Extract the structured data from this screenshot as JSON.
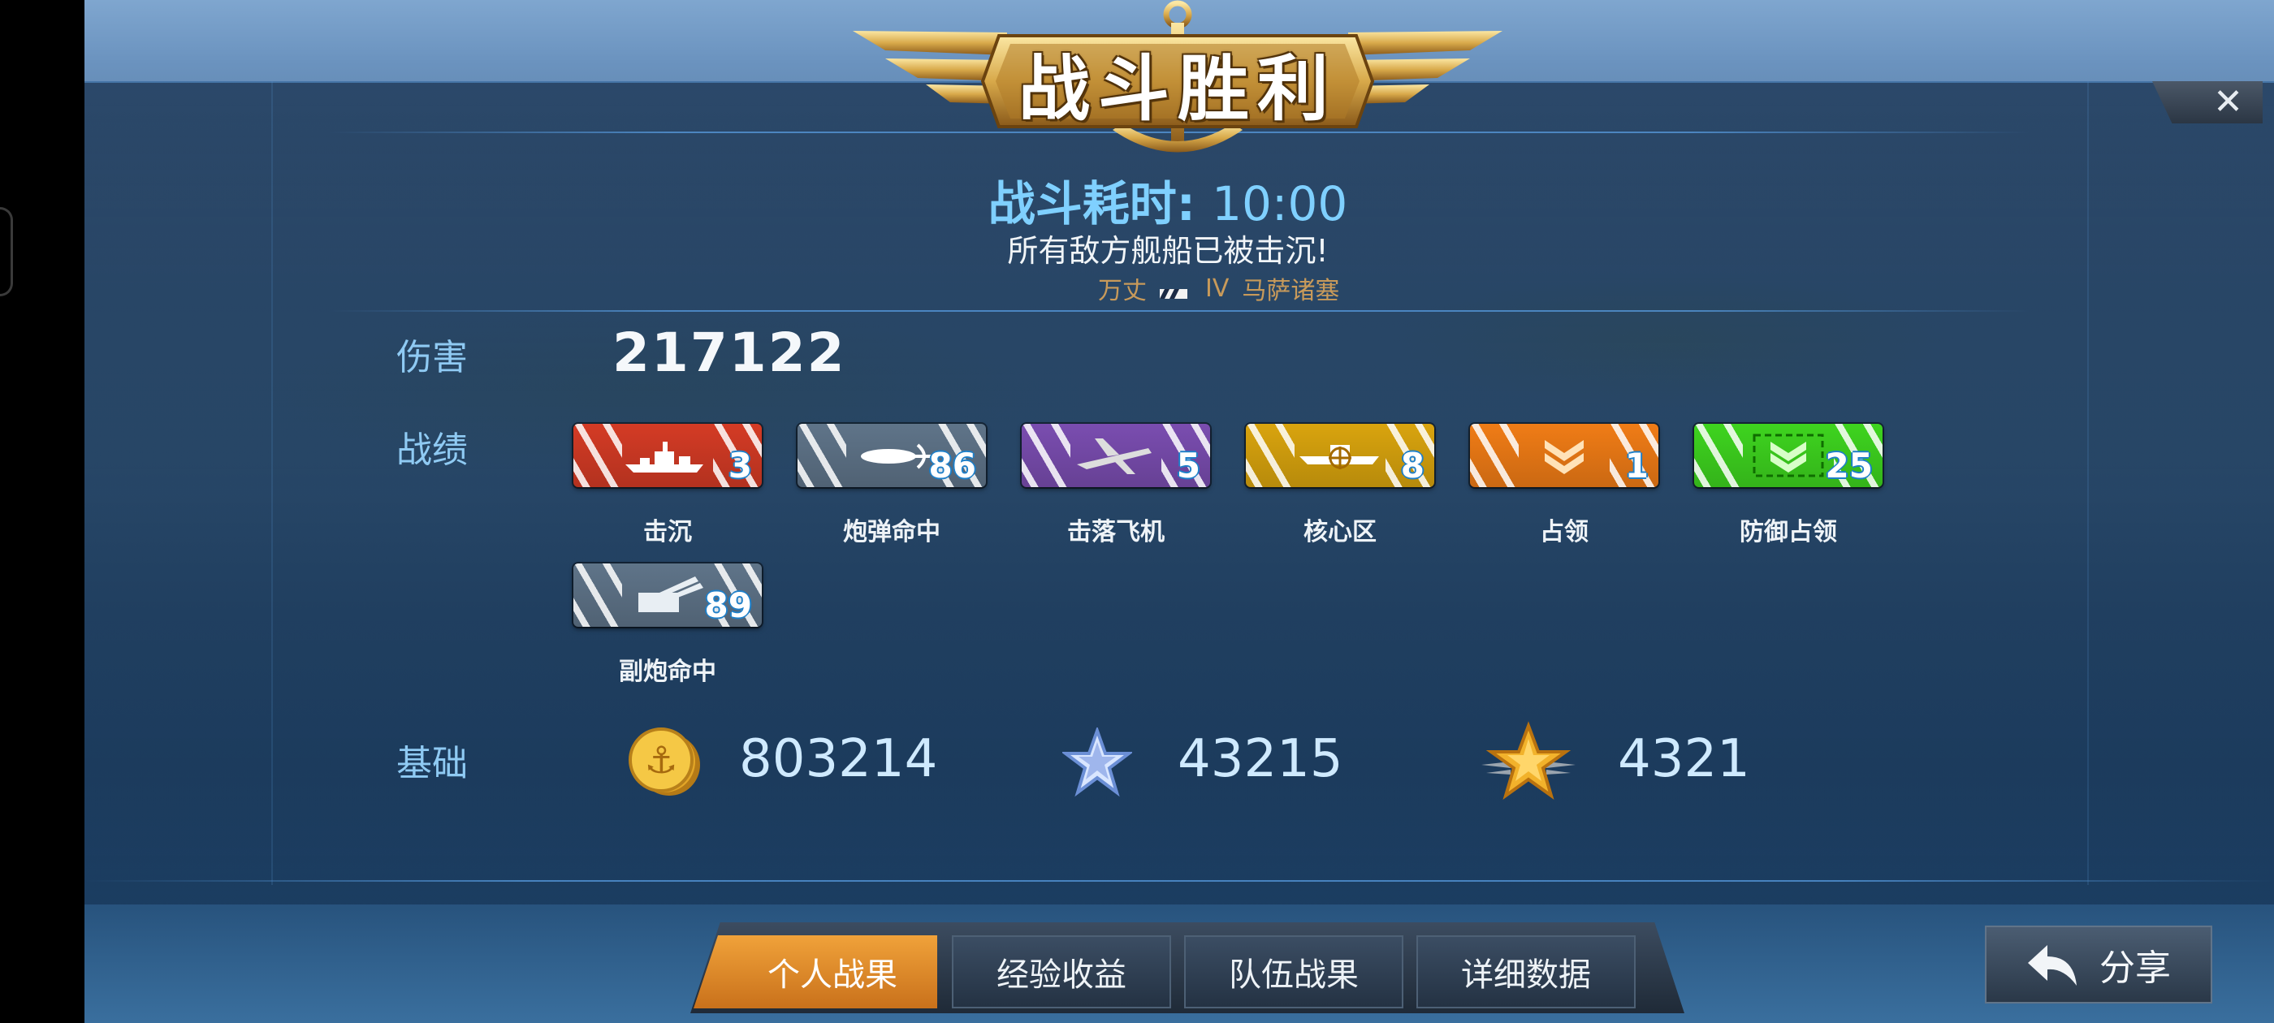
{
  "header": {
    "banner_title": "战斗胜利",
    "duration_label": "战斗耗时:",
    "duration_value": "10:00",
    "result_message": "所有敌方舰船已被击沉!",
    "ship": {
      "player": "万丈",
      "tier": "IV",
      "ship_name": "马萨诸塞"
    }
  },
  "rows": {
    "damage_label": "伤害",
    "damage_value": "217122",
    "achievements_label": "战绩",
    "base_label": "基础"
  },
  "medals": [
    {
      "label": "击沉",
      "count": "3",
      "color": "#d43b25",
      "icon": "ship-icon"
    },
    {
      "label": "炮弹命中",
      "count": "86",
      "color": "#5f7489",
      "icon": "shell-icon"
    },
    {
      "label": "击落飞机",
      "count": "5",
      "color": "#7a4db0",
      "icon": "plane-icon"
    },
    {
      "label": "核心区",
      "count": "8",
      "color": "#d9a40e",
      "icon": "core-area-icon"
    },
    {
      "label": "占领",
      "count": "1",
      "color": "#f07c16",
      "icon": "capture-icon"
    },
    {
      "label": "防御占领",
      "count": "25",
      "color": "#3ed41f",
      "icon": "defend-capture-icon"
    },
    {
      "label": "副炮命中",
      "count": "89",
      "color": "#5f7489",
      "icon": "secondary-gun-icon"
    }
  ],
  "base": {
    "silver": "803214",
    "experience": "43215",
    "commander_experience": "4321"
  },
  "tabs": [
    {
      "label": "个人战果",
      "active": true
    },
    {
      "label": "经验收益",
      "active": false
    },
    {
      "label": "队伍战果",
      "active": false
    },
    {
      "label": "详细数据",
      "active": false
    }
  ],
  "share_label": "分享",
  "close_icon": "close-icon"
}
